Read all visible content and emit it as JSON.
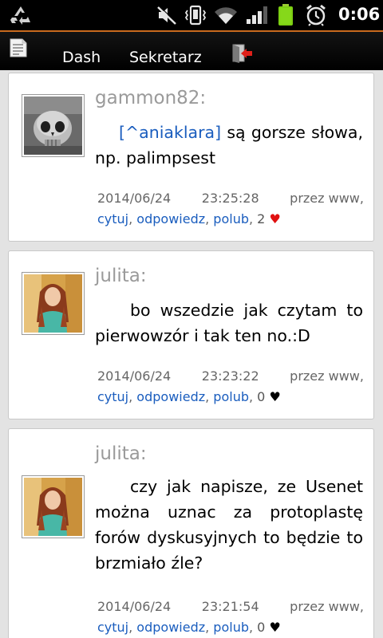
{
  "status_bar": {
    "time": "0:06",
    "icons": [
      "recycle-icon",
      "mute-icon",
      "vibrate-icon",
      "wifi-icon",
      "signal-icon",
      "battery-icon",
      "alarm-icon"
    ],
    "battery_color": "#7ccf12"
  },
  "action_bar": {
    "accent_color": "#c96a1e",
    "tabs": [
      {
        "label": "Dash"
      },
      {
        "label": "Sekretarz"
      }
    ]
  },
  "posts": [
    {
      "author": "gammon82:",
      "mention": "[^aniaklara]",
      "text": " są gorsze słowa, np. palimpsest",
      "date": "2014/06/24",
      "time": "23:25:28",
      "via": "przez www,",
      "actions": {
        "quote": "cytuj",
        "reply": "odpowiedz",
        "like": "polub"
      },
      "likes": "2",
      "liked": true
    },
    {
      "author": "julita:",
      "mention": "",
      "text": "bo wszedzie jak czytam to pierwowzór i tak ten no.:D",
      "date": "2014/06/24",
      "time": "23:23:22",
      "via": "przez www,",
      "actions": {
        "quote": "cytuj",
        "reply": "odpowiedz",
        "like": "polub"
      },
      "likes": "0",
      "liked": false
    },
    {
      "author": "julita:",
      "mention": "",
      "text": "czy jak napisze, ze Usenet można uznac za protoplastę forów dyskusyjnych to będzie to brzmiało źle?",
      "date": "2014/06/24",
      "time": "23:21:54",
      "via": "przez www,",
      "actions": {
        "quote": "cytuj",
        "reply": "odpowiedz",
        "like": "polub"
      },
      "likes": "0",
      "liked": false
    }
  ],
  "colors": {
    "link": "#1a5dbe",
    "heart_liked": "#e01010",
    "author": "#9a9a9a"
  }
}
